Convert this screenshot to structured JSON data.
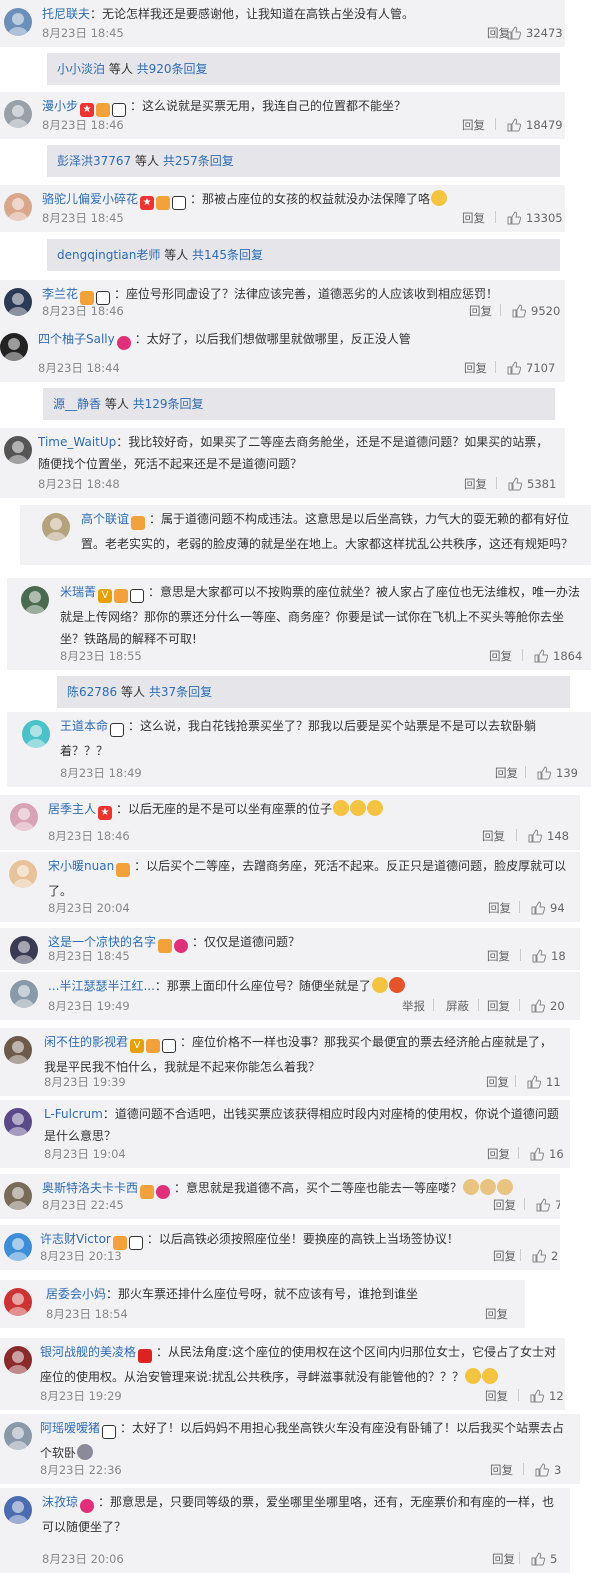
{
  "actions": {
    "reply": "回复",
    "report": "举报",
    "block": "屏蔽"
  },
  "comments": [
    {
      "name": "托尼联夫",
      "text": "：无论怎样我还是要感谢他，让我知道在高铁占坐没有人管。",
      "time": "8月23日 18:45",
      "likes": "32473",
      "badges": []
    },
    {
      "name": "漫小步",
      "text": "：这么说就是买票无用，我连自己的位置都不能坐？",
      "time": "8月23日 18:46",
      "likes": "18479",
      "badges": [
        "red",
        "orange",
        "panda"
      ]
    },
    {
      "name": "骆驼儿偏爱小碎花",
      "text": "：那被占座位的女孩的权益就没办法保障了咯",
      "time": "8月23日 18:45",
      "likes": "13305",
      "badges": [
        "red",
        "orange",
        "panda"
      ],
      "emoji": [
        "yellow"
      ]
    },
    {
      "name": "李兰花",
      "text": "：座位号形同虚设了？法律应该完善，道德恶劣的人应该收到相应惩罚！",
      "time": "8月23日 18:46",
      "likes": "9520",
      "badges": [
        "orange",
        "panda"
      ]
    },
    {
      "name": "四个柚子Sally",
      "text": "：太好了，以后我们想做哪里就做哪里，反正没人管",
      "time": "8月23日 18:44",
      "likes": "7107",
      "badges": [
        "heart"
      ]
    },
    {
      "name": "Time_WaitUp",
      "text": "：我比较好奇，如果买了二等座去商务舱坐，还是不是道德问题？如果买的站票，随便找个位置坐，死活不起来还是不是道德问题？",
      "time": "8月23日 18:48",
      "likes": "5381",
      "badges": []
    },
    {
      "name": "高个联谊",
      "text": "：属于道德问题不构成违法。这意思是以后坐高铁，力气大的耍无赖的都有好位置。老老实实的，老弱的脸皮薄的就是坐在地上。大家都这样扰乱公共秩序，这还有规矩吗？",
      "time": "",
      "likes": "",
      "badges": [
        "orange"
      ]
    },
    {
      "name": "米瑞菁",
      "text": "：意思是大家都可以不按购票的座位就坐？被人家占了座位也无法维权，唯一办法就是上传网络？那你的票还分什么一等座、商务座？你要是试一试你在飞机上不买头等舱你去坐坐？铁路局的解释不可取!",
      "time": "8月23日 18:55",
      "likes": "1864",
      "badges": [
        "v",
        "orange",
        "panda"
      ]
    },
    {
      "name": "王道本命",
      "text": "：这么说，我白花钱抢票买坐了？那我以后要是买个站票是不是可以去软卧躺着？？？",
      "time": "8月23日 18:49",
      "likes": "139",
      "badges": [
        "panda"
      ]
    },
    {
      "name": "居季主人",
      "text": "：以后无座的是不是可以坐有座票的位子",
      "time": "8月23日 18:46",
      "likes": "148",
      "badges": [
        "red"
      ],
      "emoji": [
        "yellow",
        "yellow",
        "yellow"
      ]
    },
    {
      "name": "宋小暖nuan",
      "text": "：以后买个二等座，去蹭商务座，死活不起来。反正只是道德问题，脸皮厚就可以了。",
      "time": "8月23日 20:04",
      "likes": "94",
      "badges": [
        "orange"
      ]
    },
    {
      "name": "这是一个凉快的名字",
      "text": "：仅仅是道德问题？",
      "time": "8月23日 18:45",
      "likes": "18",
      "badges": [
        "orange",
        "heart"
      ]
    },
    {
      "name": "...半江瑟瑟半江红...",
      "text": "：那票上面印什么座位号？随便坐就是了",
      "time": "8月23日 19:49",
      "likes": "20",
      "badges": [],
      "emoji": [
        "yellow",
        "red"
      ]
    },
    {
      "name": "闲不住的影视君",
      "text": "：座位价格不一样也没事？那我买个最便宜的票去经济舱占座就是了，我是平民我不怕什么，我就是不起来你能怎么着我？",
      "time": "8月23日 19:39",
      "likes": "11",
      "badges": [
        "v",
        "orange",
        "panda"
      ]
    },
    {
      "name": "L-Fulcrum",
      "text": "：道德问题不合适吧，出钱买票应该获得相应时段内对座椅的使用权，你说个道德问题是什么意思？",
      "time": "8月23日 19:04",
      "likes": "16",
      "badges": []
    },
    {
      "name": "奥斯特洛夫卡卡西",
      "text": "：意思就是我道德不高，买个二等座也能去一等座喽？",
      "time": "8月23日 22:45",
      "likes": "7",
      "badges": [
        "orange",
        "heart"
      ],
      "emoji": [
        "tan",
        "tan",
        "tan"
      ]
    },
    {
      "name": "许志财Victor",
      "text": "：以后高铁必须按照座位坐！要换座的高铁上当场签协议！",
      "time": "8月23日 20:13",
      "likes": "2",
      "badges": [
        "orange",
        "panda"
      ]
    },
    {
      "name": "居委会小妈",
      "text": "：那火车票还排什么座位号呀，就不应该有号，谁抢到谁坐",
      "time": "8月23日 18:54",
      "likes": "",
      "badges": []
    },
    {
      "name": "银河战舰的美凌格",
      "text": "：从民法角度:这个座位的使用权在这个区间内归那位女士，它侵占了女士对座位的使用权。从治安管理来说:扰乱公共秩序，寻衅滋事就没有能管他的？？？",
      "time": "8月23日 19:29",
      "likes": "12",
      "badges": [
        "flag"
      ],
      "emoji": [
        "yellow",
        "yellow"
      ]
    },
    {
      "name": "阿瑶嗳嗳猪",
      "text": "：太好了！以后妈妈不用担心我坐高铁火车没有座没有卧铺了！以后我买个站票去占个软卧",
      "time": "8月23日 22:36",
      "likes": "3",
      "badges": [
        "panda"
      ],
      "emoji": [
        "gray"
      ]
    },
    {
      "name": "沫孜琼",
      "text": "：那意思是，只要同等级的票，爱坐哪里坐哪里咯，还有，无座票价和有座的一样，也可以随便坐了？",
      "time": "8月23日 20:06",
      "likes": "5",
      "badges": [
        "heart"
      ]
    }
  ],
  "replies": [
    {
      "name": "小小淡泊",
      "mid": " 等人 ",
      "count": "共920条回复"
    },
    {
      "name": "彭泽洪37767",
      "mid": " 等人 ",
      "count": "共257条回复"
    },
    {
      "name": "dengqingtian老师",
      "mid": " 等人 ",
      "count": "共145条回复"
    },
    {
      "name": "源__静香",
      "mid": " 等人 ",
      "count": "共129条回复"
    },
    {
      "name": "陈62786",
      "mid": " 等人 ",
      "count": "共37条回复"
    }
  ],
  "colors": {
    "link": "#2d6cb5",
    "card": "#f2f2f5",
    "reply_box": "#e6e6ea"
  }
}
